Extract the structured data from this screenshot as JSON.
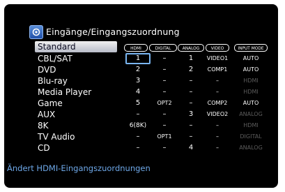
{
  "title": "Eingänge/Eingangszuordnung",
  "columns": [
    "HDMI",
    "DIGITAL",
    "ANALOG",
    "VIDEO",
    "INPUT MODE"
  ],
  "header_row_label": "Standard",
  "rows": [
    {
      "label": "CBL/SAT",
      "hdmi": "1",
      "digital": "–",
      "analog": "1",
      "video": "VIDEO1",
      "mode": "AUTO",
      "mode_active": true
    },
    {
      "label": "DVD",
      "hdmi": "2",
      "digital": "–",
      "analog": "2",
      "video": "COMP1",
      "mode": "AUTO",
      "mode_active": true
    },
    {
      "label": "Blu-ray",
      "hdmi": "3",
      "digital": "–",
      "analog": "–",
      "video": "–",
      "mode": "HDMI",
      "mode_active": false
    },
    {
      "label": "Media Player",
      "hdmi": "4",
      "digital": "–",
      "analog": "–",
      "video": "–",
      "mode": "HDMI",
      "mode_active": false
    },
    {
      "label": "Game",
      "hdmi": "5",
      "digital": "OPT2",
      "analog": "–",
      "video": "COMP2",
      "mode": "AUTO",
      "mode_active": true
    },
    {
      "label": "AUX",
      "hdmi": "–",
      "digital": "–",
      "analog": "3",
      "video": "VIDEO2",
      "mode": "ANALOG",
      "mode_active": false
    },
    {
      "label": "8K",
      "hdmi": "6(8K)",
      "digital": "–",
      "analog": "–",
      "video": "–",
      "mode": "HDMI",
      "mode_active": false
    },
    {
      "label": "TV Audio",
      "hdmi": "–",
      "digital": "OPT1",
      "analog": "–",
      "video": "–",
      "mode": "DIGITAL",
      "mode_active": false
    },
    {
      "label": "CD",
      "hdmi": "–",
      "digital": "–",
      "analog": "4",
      "video": "–",
      "mode": "ANALOG",
      "mode_active": false
    }
  ],
  "focused_cell": {
    "row": "CBL/SAT",
    "column": "HDMI"
  },
  "footer_hint": "Ändert HDMI-Eingangszuordnungen",
  "colors": {
    "accent": "#7ab6f2",
    "hint": "#6ea8e8",
    "inactive": "#5d5d5d"
  }
}
